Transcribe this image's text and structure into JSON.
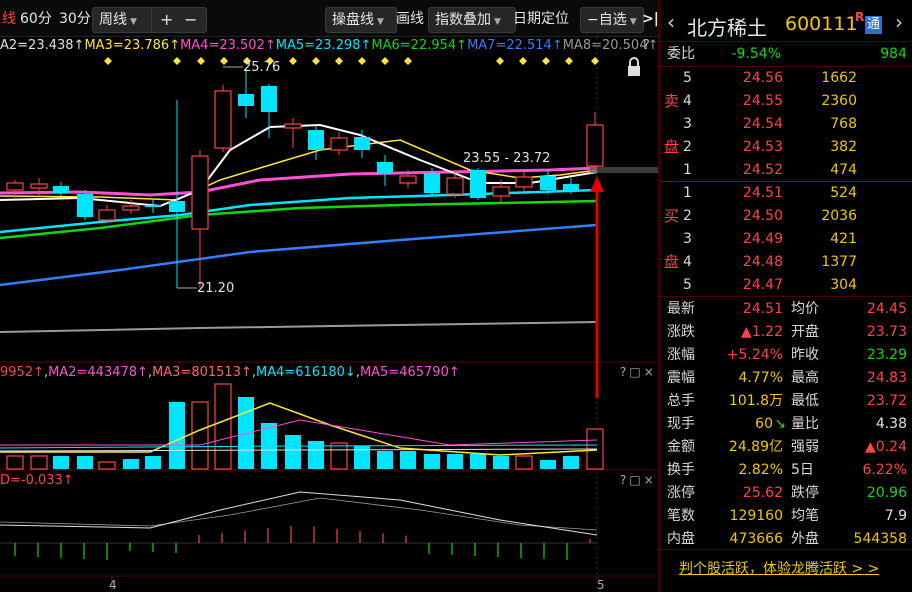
{
  "toolbar": {
    "period_cut": "线",
    "period_60": "60分",
    "period_30": "30分",
    "period_week": "周线",
    "zoom_in": "+",
    "zoom_out": "−",
    "panel_line": "操盘线",
    "draw_line": "画线",
    "index_overlay": "指数叠加",
    "date_locate": "日期定位",
    "watchlist": "−自选",
    "expand": ">|"
  },
  "ma_main": {
    "ma2": "A2=23.438↑",
    "ma3": "MA3=23.786↑",
    "ma4": "MA4=23.502↑",
    "ma5": "MA5=23.298↑",
    "ma6": "MA6=22.954↑",
    "ma7": "MA7=22.514↑",
    "ma8": "MA8=20.504↑",
    "help": "?"
  },
  "ma_volume": {
    "ma1": "9952↑",
    "ma2": "MA2=443478↑",
    "ma3": "MA3=801513↑",
    "ma4": "MA4=616180↓",
    "ma5": "MA5=465790↑"
  },
  "macd_label": "D=-0.033↑",
  "panel_controls": {
    "help": "?",
    "max": "□",
    "close": "×"
  },
  "annotations": {
    "high": "25.76",
    "low": "21.20",
    "range": "23.55 - 23.72"
  },
  "date_labels": {
    "left": "4",
    "right": "5"
  },
  "quote": {
    "name": "北方稀土",
    "code": "600111",
    "badge_r": "R",
    "badge": "通",
    "weibi_label": "委比",
    "weibi_pct": "-9.54%",
    "weibi_val": "984",
    "sell_label_1": "卖",
    "sell_label_2": "盘",
    "buy_label_1": "买",
    "buy_label_2": "盘",
    "sell": [
      {
        "level": "5",
        "price": "24.56",
        "vol": "1662"
      },
      {
        "level": "4",
        "price": "24.55",
        "vol": "2360"
      },
      {
        "level": "3",
        "price": "24.54",
        "vol": "768"
      },
      {
        "level": "2",
        "price": "24.53",
        "vol": "382"
      },
      {
        "level": "1",
        "price": "24.52",
        "vol": "474"
      }
    ],
    "buy": [
      {
        "level": "1",
        "price": "24.51",
        "vol": "524"
      },
      {
        "level": "2",
        "price": "24.50",
        "vol": "2036"
      },
      {
        "level": "3",
        "price": "24.49",
        "vol": "421"
      },
      {
        "level": "4",
        "price": "24.48",
        "vol": "1377"
      },
      {
        "level": "5",
        "price": "24.47",
        "vol": "304"
      }
    ],
    "stats": [
      {
        "l1": "最新",
        "v1": "24.51",
        "l2": "均价",
        "v2": "24.45"
      },
      {
        "l1": "涨跌",
        "v1": "▲1.22",
        "l2": "开盘",
        "v2": "23.73"
      },
      {
        "l1": "涨幅",
        "v1": "+5.24%",
        "l2": "昨收",
        "v2": "23.29"
      },
      {
        "l1": "震幅",
        "v1": "4.77%",
        "l2": "最高",
        "v2": "24.83"
      },
      {
        "l1": "总手",
        "v1": "101.8万",
        "l2": "最低",
        "v2": "23.72"
      },
      {
        "l1": "现手",
        "v1": "60",
        "v1b": "↘",
        "l2": "量比",
        "v2": "4.38"
      },
      {
        "l1": "金额",
        "v1": "24.89亿",
        "l2": "强弱",
        "v2": "▲0.24"
      },
      {
        "l1": "换手",
        "v1": "2.82%",
        "l2": "5日",
        "v2": "6.22%"
      },
      {
        "l1": "涨停",
        "v1": "25.62",
        "l2": "跌停",
        "v2": "20.96"
      },
      {
        "l1": "笔数",
        "v1": "129160",
        "l2": "均笔",
        "v2": "7.9"
      },
      {
        "l1": "内盘",
        "v1": "473666",
        "l2": "外盘",
        "v2": "544358"
      }
    ],
    "promo": "判个股活跃，体验龙腾活跃 > >"
  },
  "colors": {
    "up": "#ff4444",
    "down": "#00e5ff",
    "ma2": "#ffffff",
    "ma3": "#ffe53a",
    "ma4": "#ff4fd8",
    "ma5": "#00e5ff",
    "ma6": "#13d613",
    "ma7": "#2f7fff",
    "ma8": "#9a9a9a",
    "ask_label": "#ff4444",
    "bid_label": "#13d613"
  }
}
